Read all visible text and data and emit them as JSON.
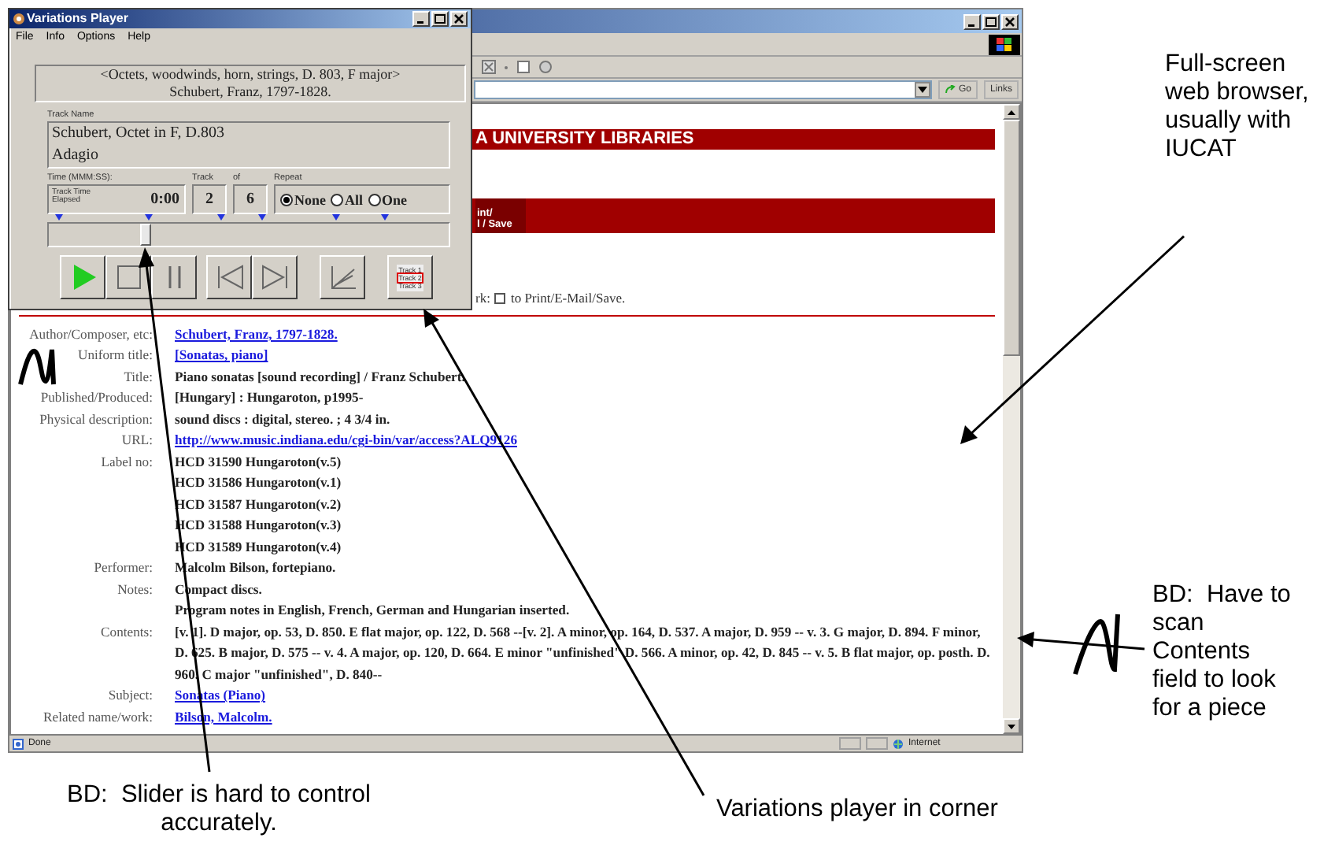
{
  "browser": {
    "address_buttons": [
      "Go",
      "Links"
    ],
    "banner": "A UNIVERSITY LIBRARIES",
    "bar_button": [
      "int/",
      "l / Save"
    ],
    "mark_line": {
      "before": "rk:",
      "checked": false,
      "after": "to Print/E-Mail/Save."
    },
    "record": [
      {
        "label": "Author/Composer, etc:",
        "lines": [
          {
            "text": "Schubert, Franz, 1797-1828.",
            "link": true
          }
        ]
      },
      {
        "label": "Uniform title:",
        "lines": [
          {
            "text": "[Sonatas, piano]",
            "link": true
          }
        ]
      },
      {
        "label": "Title:",
        "lines": [
          {
            "text": "Piano sonatas [sound recording] / Franz Schubert.",
            "link": false
          }
        ]
      },
      {
        "label": "Published/Produced:",
        "lines": [
          {
            "text": "[Hungary] : Hungaroton, p1995-",
            "link": false
          }
        ]
      },
      {
        "label": "Physical description:",
        "lines": [
          {
            "text": "sound discs : digital, stereo. ; 4 3/4 in.",
            "link": false
          }
        ]
      },
      {
        "label": "URL:",
        "lines": [
          {
            "text": "http://www.music.indiana.edu/cgi-bin/var/access?ALQ9126",
            "link": true
          }
        ]
      },
      {
        "label": "Label no:",
        "lines": [
          {
            "text": "HCD 31590 Hungaroton(v.5)",
            "link": false
          },
          {
            "text": "HCD 31586 Hungaroton(v.1)",
            "link": false
          },
          {
            "text": "HCD 31587 Hungaroton(v.2)",
            "link": false
          },
          {
            "text": "HCD 31588 Hungaroton(v.3)",
            "link": false
          },
          {
            "text": "HCD 31589 Hungaroton(v.4)",
            "link": false
          }
        ]
      },
      {
        "label": "Performer:",
        "lines": [
          {
            "text": "Malcolm Bilson, fortepiano.",
            "link": false
          }
        ]
      },
      {
        "label": "Notes:",
        "lines": [
          {
            "text": "Compact discs.",
            "link": false
          },
          {
            "text": "Program notes in English, French, German and Hungarian inserted.",
            "link": false
          }
        ]
      },
      {
        "label": "Contents:",
        "lines": [
          {
            "text": "[v. 1]. D major, op. 53, D. 850. E flat major, op. 122, D. 568 --[v. 2]. A minor, op. 164, D. 537. A major, D. 959 -- v. 3. G major, D. 894. F minor, D. 625. B major, D. 575 -- v. 4. A major, op. 120, D. 664. E minor \"unfinished\" D. 566. A minor, op. 42, D. 845 -- v. 5. B flat major, op. posth. D. 960. C major \"unfinished\", D. 840--",
            "link": false
          }
        ]
      },
      {
        "label": "Subject:",
        "lines": [
          {
            "text": "Sonatas (Piano)",
            "link": true
          }
        ]
      },
      {
        "label": "Related name/work:",
        "lines": [
          {
            "text": "Bilson, Malcolm.",
            "link": true
          }
        ]
      }
    ],
    "status": "Done",
    "zone": "Internet"
  },
  "player": {
    "title": "Variations Player",
    "menu": [
      "File",
      "Info",
      "Options",
      "Help"
    ],
    "work_title": [
      "<Octets, woodwinds, horn, strings, D. 803, F major>",
      "Schubert, Franz, 1797-1828."
    ],
    "track_name_label": "Track Name",
    "track_name": [
      "Schubert, Octet in F, D.803",
      "Adagio"
    ],
    "time_label": "Time (MMM:SS):",
    "track_label": "Track",
    "of_label": "of",
    "repeat_label": "Repeat",
    "elapsed_label": "Track Time Elapsed",
    "time": "0:00",
    "track": "2",
    "track_count": "6",
    "repeat_options": [
      {
        "label": "None",
        "selected": true
      },
      {
        "label": "All",
        "selected": false
      },
      {
        "label": "One",
        "selected": false
      }
    ],
    "slider": {
      "level": 0.24
    },
    "track_list": [
      {
        "label": "Track 1",
        "selected": false
      },
      {
        "label": "Track 2",
        "selected": true
      },
      {
        "label": "Track 3",
        "selected": false
      }
    ]
  },
  "annotations": [
    {
      "kind": "browser",
      "text": "Full-screen web browser, usually with IUCAT"
    },
    {
      "kind": "contents",
      "text": "BD:  Have to scan Contents field to look for a piece"
    },
    {
      "kind": "slider",
      "text": "BD:  Slider is hard to control accurately."
    },
    {
      "kind": "corner",
      "text": "Variations player in corner"
    }
  ]
}
